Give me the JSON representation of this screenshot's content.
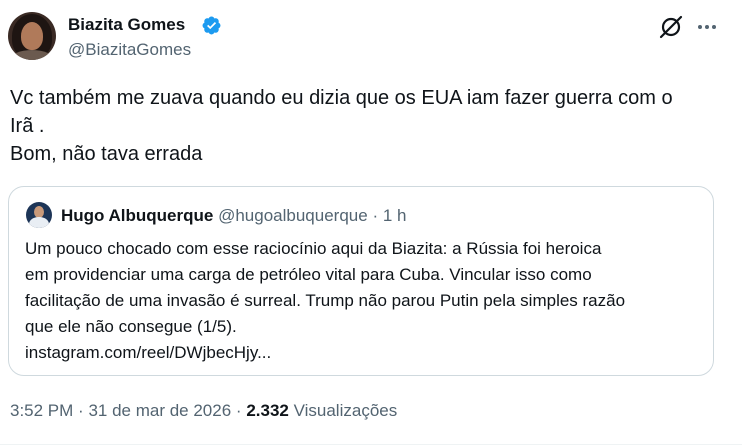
{
  "author": {
    "name": "Biazita Gomes",
    "handle": "@BiazitaGomes",
    "verified": true
  },
  "header_actions": {
    "grok_icon": "grok-slash-icon",
    "more_icon": "more-dots-icon"
  },
  "tweet": {
    "lines": [
      "Vc também me zuava quando eu dizia que os EUA iam fazer guerra com o",
      "Irã .",
      "Bom, não tava errada"
    ]
  },
  "quote": {
    "name": "Hugo Albuquerque",
    "handle": "@hugoalbuquerque",
    "separator": "·",
    "time": "1 h",
    "lines": [
      "Um pouco chocado com esse raciocínio aqui da Biazita: a Rússia foi heroica",
      "em providenciar uma carga de petróleo vital para Cuba. Vincular isso como",
      "facilitação de uma invasão é surreal. Trump não parou Putin pela simples razão",
      "que ele não consegue (1/5).",
      "instagram.com/reel/DWjbecHjy..."
    ]
  },
  "footer": {
    "time": "3:52 PM",
    "dot1": "·",
    "date": "31 de mar de 2026",
    "dot2": "·",
    "views_count": "2.332",
    "views_label": "Visualizações"
  },
  "colors": {
    "text_primary": "#0f1419",
    "text_secondary": "#536471",
    "verified_blue": "#1d9bf0",
    "border": "#cfd9de"
  }
}
